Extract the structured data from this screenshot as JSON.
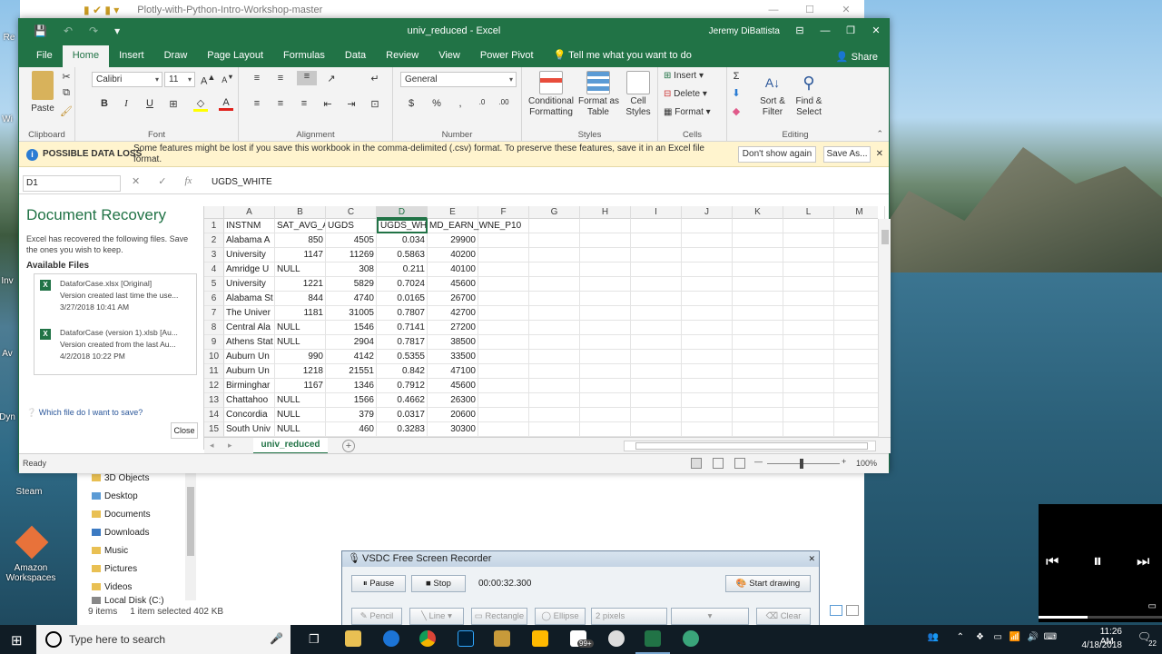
{
  "explorer": {
    "title": "Plotly-with-Python-Intro-Workshop-master",
    "nav_items": [
      "3D Objects",
      "Desktop",
      "Documents",
      "Downloads",
      "Music",
      "Pictures",
      "Videos",
      "Local Disk (C:)"
    ],
    "status_items": "9 items",
    "status_selected": "1 item selected  402 KB"
  },
  "desktop_icons": [
    "Re",
    "Wi",
    "Inv",
    "Av",
    "Dyn",
    "Steam",
    "Amazon Workspaces"
  ],
  "excel": {
    "title": "univ_reduced  -  Excel",
    "user": "Jeremy DiBattista",
    "tabs": [
      "File",
      "Home",
      "Insert",
      "Draw",
      "Page Layout",
      "Formulas",
      "Data",
      "Review",
      "View",
      "Power Pivot"
    ],
    "tell_me": "Tell me what you want to do",
    "share": "Share",
    "ribbon": {
      "paste": "Paste",
      "font_name": "Calibri",
      "font_size": "11",
      "number_format": "General",
      "conditional_formatting": "Conditional\nFormatting",
      "format_as_table": "Format as\nTable",
      "cell_styles": "Cell\nStyles",
      "insert": "Insert",
      "delete": "Delete",
      "format": "Format",
      "sort_filter": "Sort &\nFilter",
      "find_select": "Find &\nSelect",
      "groups": [
        "Clipboard",
        "Font",
        "Alignment",
        "Number",
        "Styles",
        "Cells",
        "Editing"
      ]
    },
    "notice": {
      "heading": "POSSIBLE DATA LOSS",
      "message": "Some features might be lost if you save this workbook in the comma-delimited (.csv) format. To preserve these features, save it in an Excel file format.",
      "dont_show": "Don't show again",
      "save_as": "Save As..."
    },
    "name_box": "D1",
    "formula": "UGDS_WHITE",
    "recovery": {
      "title": "Document Recovery",
      "intro": "Excel has recovered the following files.  Save the ones you wish to keep.",
      "available": "Available Files",
      "files": [
        {
          "name": "DataforCase.xlsx  [Original]",
          "desc": "Version created last time the use...",
          "date": "3/27/2018 10:41 AM"
        },
        {
          "name": "DataforCase (version 1).xlsb  [Au...",
          "desc": "Version created from the last Au...",
          "date": "4/2/2018 10:22 PM"
        }
      ],
      "which": "Which file do I want to save?",
      "close": "Close"
    },
    "columns": [
      "A",
      "B",
      "C",
      "D",
      "E",
      "F",
      "G",
      "H",
      "I",
      "J",
      "K",
      "L",
      "M"
    ],
    "rows": [
      [
        "INSTNM",
        "SAT_AVG_ALL",
        "UGDS",
        "UGDS_WH",
        "MD_EARN_WNE_P10"
      ],
      [
        "Alabama A",
        "850",
        "4505",
        "0.034",
        "29900"
      ],
      [
        "University",
        "1147",
        "11269",
        "0.5863",
        "40200"
      ],
      [
        "Amridge U",
        "NULL",
        "308",
        "0.211",
        "40100"
      ],
      [
        "University",
        "1221",
        "5829",
        "0.7024",
        "45600"
      ],
      [
        "Alabama St",
        "844",
        "4740",
        "0.0165",
        "26700"
      ],
      [
        "The Univer",
        "1181",
        "31005",
        "0.7807",
        "42700"
      ],
      [
        "Central Ala",
        "NULL",
        "1546",
        "0.7141",
        "27200"
      ],
      [
        "Athens Stat",
        "NULL",
        "2904",
        "0.7817",
        "38500"
      ],
      [
        "Auburn Un",
        "990",
        "4142",
        "0.5355",
        "33500"
      ],
      [
        "Auburn Un",
        "1218",
        "21551",
        "0.842",
        "47100"
      ],
      [
        "Birminghar",
        "1167",
        "1346",
        "0.7912",
        "45600"
      ],
      [
        "Chattahoo",
        "NULL",
        "1566",
        "0.4662",
        "26300"
      ],
      [
        "Concordia",
        "NULL",
        "379",
        "0.0317",
        "20600"
      ],
      [
        "South Univ",
        "NULL",
        "460",
        "0.3283",
        "30300"
      ]
    ],
    "sheet_tab": "univ_reduced",
    "status": "Ready",
    "zoom": "100%"
  },
  "recorder": {
    "title": "VSDC Free Screen Recorder",
    "pause": "Pause",
    "stop": "Stop",
    "timer": "00:00:32.300",
    "start_drawing": "Start drawing",
    "pencil": "Pencil",
    "line": "Line",
    "rectangle": "Rectangle",
    "ellipse": "Ellipse",
    "pixels": "2 pixels",
    "clear": "Clear"
  },
  "taskbar": {
    "search_placeholder": "Type here to search",
    "time": "11:26 AM",
    "date": "4/18/2018",
    "badge": "99+",
    "notif_count": "22"
  }
}
